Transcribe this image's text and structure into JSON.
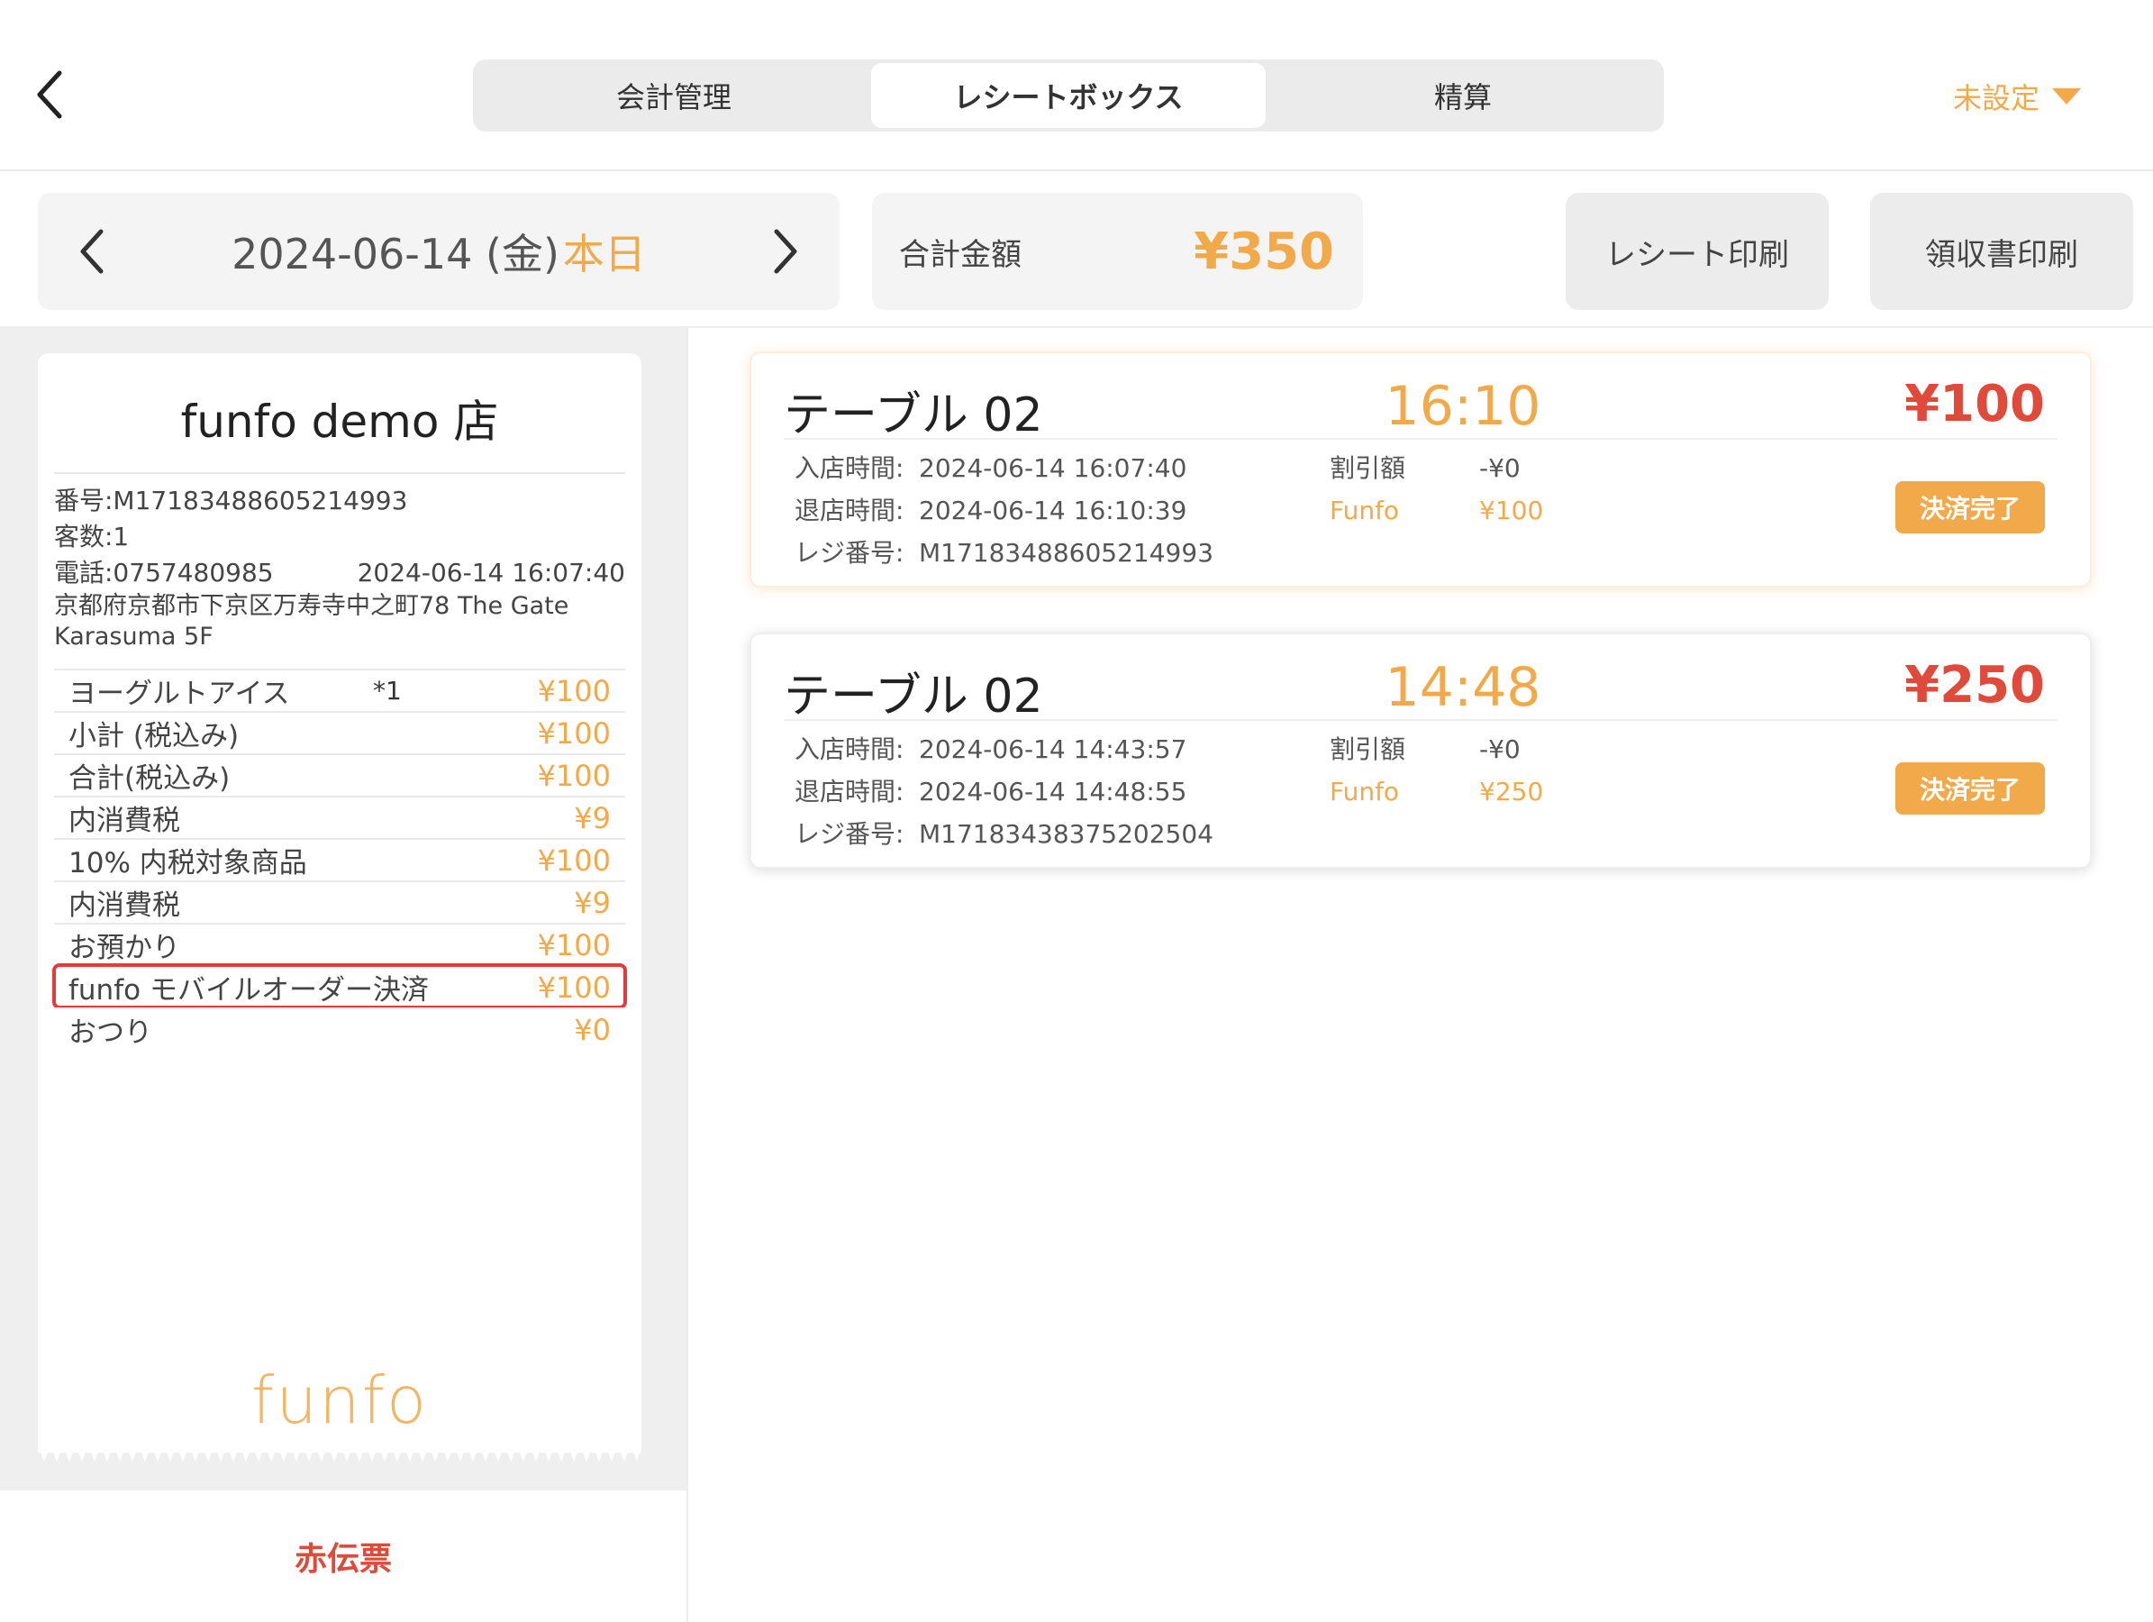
{
  "tabs": [
    {
      "label": "会計管理",
      "active": false
    },
    {
      "label": "レシートボックス",
      "active": true
    },
    {
      "label": "精算",
      "active": false
    }
  ],
  "store_selector": {
    "label": "未設定"
  },
  "date_nav": {
    "date": "2024-06-14 (金)",
    "today": "本日"
  },
  "total": {
    "label": "合計金額",
    "value": "¥350"
  },
  "buttons": {
    "print_receipt": "レシート印刷",
    "print_invoice": "領収書印刷",
    "red_slip": "赤伝票"
  },
  "receipt": {
    "store_name": "funfo demo 店",
    "number": "番号:M17183488605214993",
    "guests": "客数:1",
    "phone": "電話:0757480985",
    "datetime": "2024-06-14 16:07:40",
    "address": "京都府京都市下京区万寿寺中之町78 The Gate Karasuma 5F",
    "items": [
      {
        "label": "ヨーグルトアイス",
        "qty": "*1",
        "amount": "¥100",
        "highlight": false
      },
      {
        "label": "小計 (税込み)",
        "qty": "",
        "amount": "¥100",
        "highlight": false
      },
      {
        "label": "合計(税込み)",
        "qty": "",
        "amount": "¥100",
        "highlight": false
      },
      {
        "label": "内消費税",
        "qty": "",
        "amount": "¥9",
        "highlight": false
      },
      {
        "label": "10% 内税対象商品",
        "qty": "",
        "amount": "¥100",
        "highlight": false
      },
      {
        "label": "内消費税",
        "qty": "",
        "amount": "¥9",
        "highlight": false
      },
      {
        "label": "お預かり",
        "qty": "",
        "amount": "¥100",
        "highlight": false
      },
      {
        "label": "funfo モバイルオーダー決済",
        "qty": "",
        "amount": "¥100",
        "highlight": true
      },
      {
        "label": "おつり",
        "qty": "",
        "amount": "¥0",
        "highlight": false
      }
    ],
    "logo": "funfo"
  },
  "cards": [
    {
      "table": "テーブル 02",
      "time": "16:10",
      "amount": "¥100",
      "entry_label": "入店時間:",
      "entry": "2024-06-14 16:07:40",
      "exit_label": "退店時間:",
      "exit": "2024-06-14 16:10:39",
      "register_label": "レジ番号:",
      "register": "M17183488605214993",
      "discount_label": "割引額",
      "discount": "-¥0",
      "payment_label": "Funfo",
      "payment": "¥100",
      "status": "決済完了"
    },
    {
      "table": "テーブル 02",
      "time": "14:48",
      "amount": "¥250",
      "entry_label": "入店時間:",
      "entry": "2024-06-14 14:43:57",
      "exit_label": "退店時間:",
      "exit": "2024-06-14 14:48:55",
      "register_label": "レジ番号:",
      "register": "M17183438375202504",
      "discount_label": "割引額",
      "discount": "-¥0",
      "payment_label": "Funfo",
      "payment": "¥250",
      "status": "決済完了"
    }
  ],
  "colors": {
    "accent": "#f2a94a",
    "danger": "#e04a3a",
    "highlight_border": "#e23b3b"
  },
  "icons": {
    "back": "chevron-left-icon",
    "prev": "chevron-left-icon",
    "next": "chevron-right-icon",
    "dropdown": "caret-down-icon"
  }
}
